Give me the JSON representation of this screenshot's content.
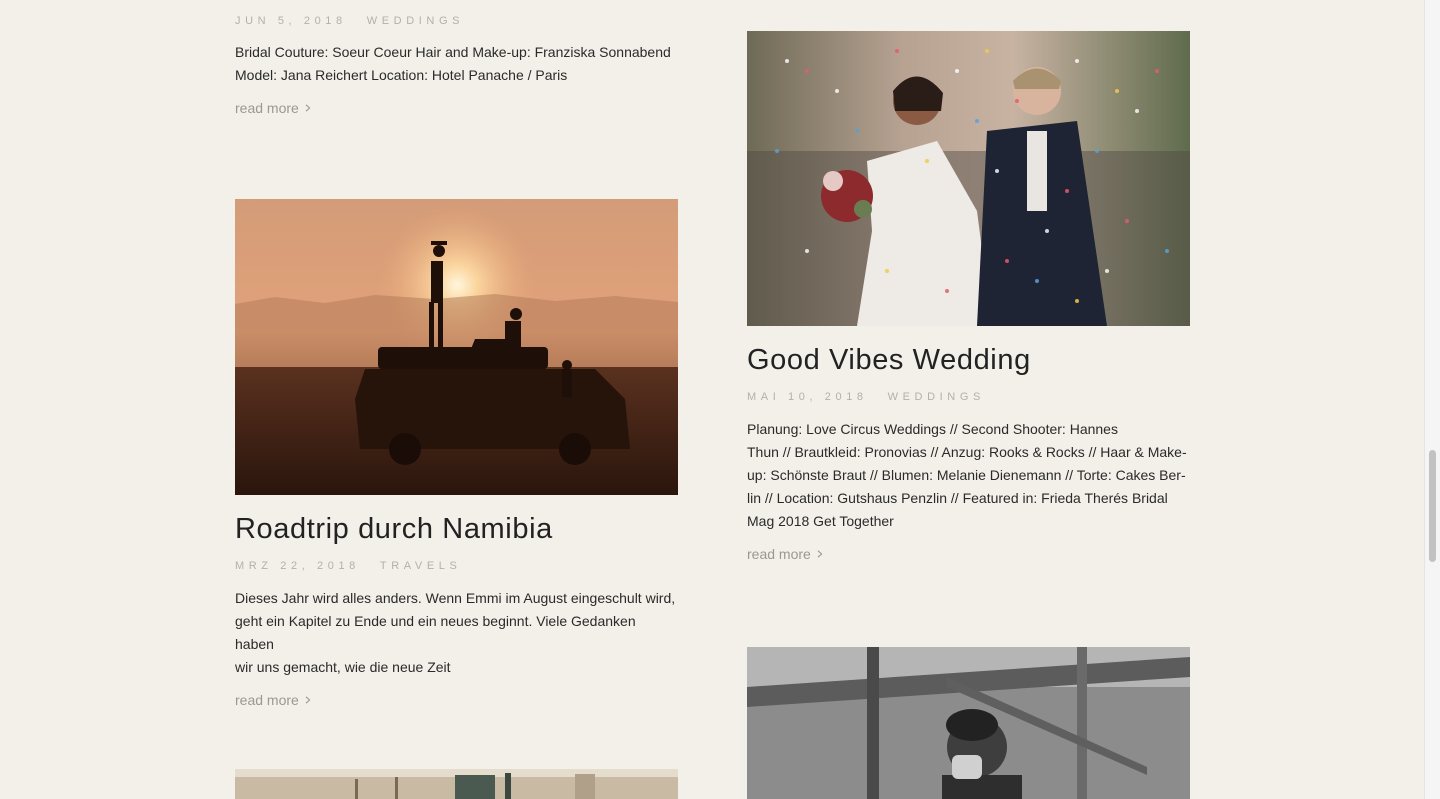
{
  "left_column": {
    "post_top": {
      "date": "JUN 5, 2018",
      "category": "WEDDINGS",
      "excerpt_line1": "Bridal Couture: Soeur Coeur Hair and Make-up: Franziska Sonnabend",
      "excerpt_line2": "Model: Jana Reichert Location: Hotel Panache / Paris",
      "read_more": "read more"
    },
    "post_namibia": {
      "title": "Roadtrip durch Namibia",
      "date": "MRZ 22, 2018",
      "category": "TRAVELS",
      "excerpt_line1": "Dieses Jahr wird alles anders. Wenn Emmi im August eingeschult wird,",
      "excerpt_line2": "geht ein Kapitel zu Ende und ein neues beginnt. Viele Gedanken haben",
      "excerpt_line3": "wir uns gemacht, wie die neue Zeit",
      "read_more": "read more"
    }
  },
  "right_column": {
    "post_good_vibes": {
      "title": "Good Vibes Wedding",
      "date": "MAI 10, 2018",
      "category": "WEDDINGS",
      "excerpt_line1": "Planung: Love Circus Weddings // Second Shooter: Hannes",
      "excerpt_line2": "Thun // Brautkleid: Pronovias // Anzug: Rooks & Rocks // Haar & Make-",
      "excerpt_line3": "up: Schönste Braut // Blumen: Melanie Dienemann // Torte: Cakes Ber-",
      "excerpt_line4": "lin // Location: Gutshaus Penzlin // Featured in: Frieda Therés Bridal",
      "excerpt_line5": "Mag 2018 Get Together",
      "read_more": "read more"
    }
  },
  "icons": {
    "read_more_arrow": "chevron-right-icon"
  },
  "colors": {
    "background": "#f3f0ea",
    "meta_text": "#b3b0aa",
    "read_more_text": "#9a9892"
  }
}
